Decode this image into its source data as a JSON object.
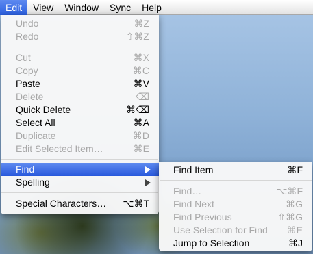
{
  "menubar": {
    "items": [
      {
        "label": "Edit",
        "active": true
      },
      {
        "label": "View"
      },
      {
        "label": "Window"
      },
      {
        "label": "Sync"
      },
      {
        "label": "Help"
      }
    ]
  },
  "edit_menu": {
    "items": [
      {
        "label": "Undo",
        "shortcut": "⌘Z",
        "enabled": false
      },
      {
        "label": "Redo",
        "shortcut": "⇧⌘Z",
        "enabled": false
      },
      {
        "label": "Cut",
        "shortcut": "⌘X",
        "enabled": false
      },
      {
        "label": "Copy",
        "shortcut": "⌘C",
        "enabled": false
      },
      {
        "label": "Paste",
        "shortcut": "⌘V",
        "enabled": true
      },
      {
        "label": "Delete",
        "shortcut": "⌫",
        "enabled": false
      },
      {
        "label": "Quick Delete",
        "shortcut": "⌘⌫",
        "enabled": true
      },
      {
        "label": "Select All",
        "shortcut": "⌘A",
        "enabled": true
      },
      {
        "label": "Duplicate",
        "shortcut": "⌘D",
        "enabled": false
      },
      {
        "label": "Edit Selected Item…",
        "shortcut": "⌘E",
        "enabled": false
      },
      {
        "label": "Find",
        "submenu": true,
        "highlighted": true
      },
      {
        "label": "Spelling",
        "submenu": true
      },
      {
        "label": "Special Characters…",
        "shortcut": "⌥⌘T",
        "enabled": true
      }
    ]
  },
  "find_menu": {
    "items": [
      {
        "label": "Find Item",
        "shortcut": "⌘F",
        "enabled": true
      },
      {
        "label": "Find…",
        "shortcut": "⌥⌘F",
        "enabled": false
      },
      {
        "label": "Find Next",
        "shortcut": "⌘G",
        "enabled": false
      },
      {
        "label": "Find Previous",
        "shortcut": "⇧⌘G",
        "enabled": false
      },
      {
        "label": "Use Selection for Find",
        "shortcut": "⌘E",
        "enabled": false
      },
      {
        "label": "Jump to Selection",
        "shortcut": "⌘J",
        "enabled": true
      }
    ]
  },
  "colors": {
    "highlight": "#3a6ee8",
    "disabled_text": "#a8a8a8"
  }
}
